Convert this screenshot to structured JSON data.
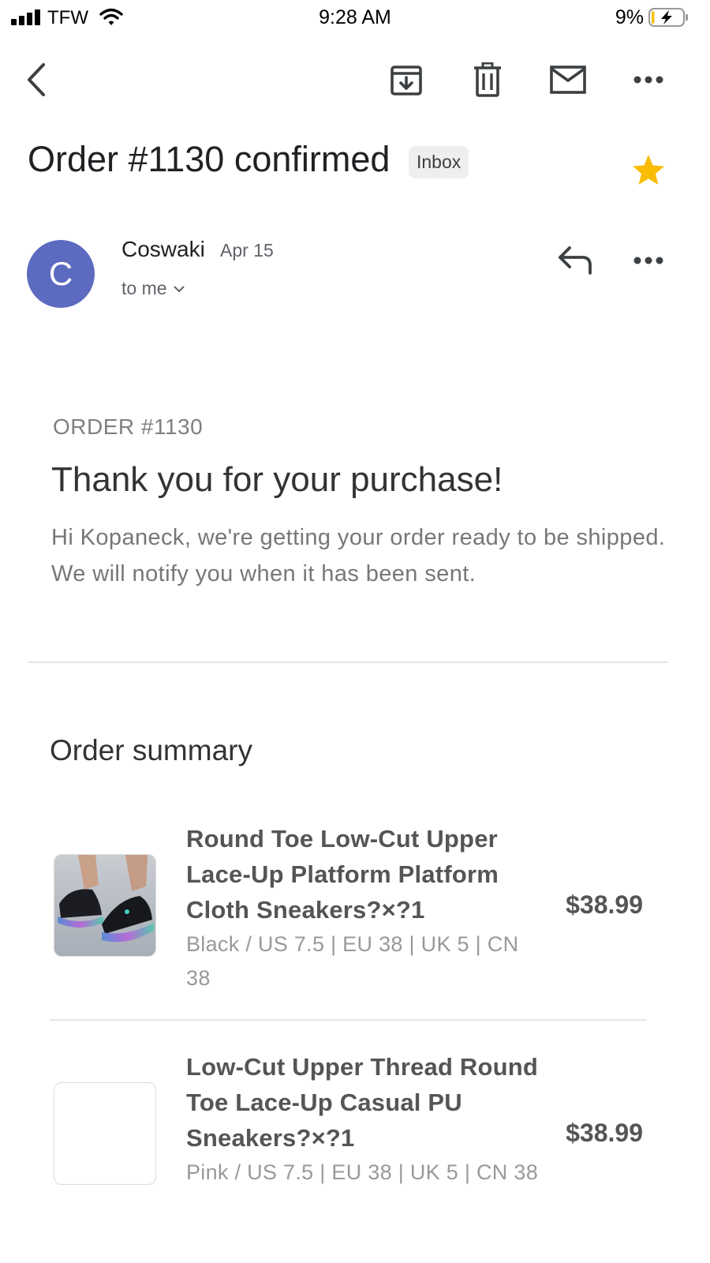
{
  "status_bar": {
    "carrier": "TFW",
    "time": "9:28 AM",
    "battery_percent": "9%",
    "battery_level": 0.09,
    "charging": true,
    "icons": [
      "signal-icon",
      "wifi-icon",
      "battery-icon",
      "charging-bolt-icon"
    ]
  },
  "toolbar": {
    "icons": [
      "back-arrow-icon",
      "archive-icon",
      "trash-icon",
      "mail-icon",
      "more-icon"
    ]
  },
  "email": {
    "subject": "Order #1130 confirmed",
    "label": "Inbox",
    "starred": true,
    "star_color": "#FBBC04",
    "sender": {
      "initial": "C",
      "name": "Coswaki",
      "date": "Apr 15",
      "recipient": "to me",
      "avatar_color": "#5C6BC0"
    }
  },
  "body": {
    "order_number": "ORDER #1130",
    "headline": "Thank you for your purchase!",
    "intro": "Hi Kopaneck, we're getting your order ready to be shipped. We will notify you when it has been sent.",
    "summary_title": "Order summary",
    "items": [
      {
        "title": "Round Toe Low-Cut Upper Lace-Up Platform Platform Cloth Sneakers?×?1",
        "variant": "Black / US 7.5 | EU 38 | UK 5 | CN 38",
        "price": "$38.99",
        "image": "sneaker-product-image"
      },
      {
        "title": "Low-Cut Upper Thread Round Toe Lace-Up Casual PU Sneakers?×?1",
        "variant": "Pink / US 7.5 | EU 38 | UK 5 | CN 38",
        "price": "$38.99",
        "image": "blank-product-image"
      }
    ]
  }
}
